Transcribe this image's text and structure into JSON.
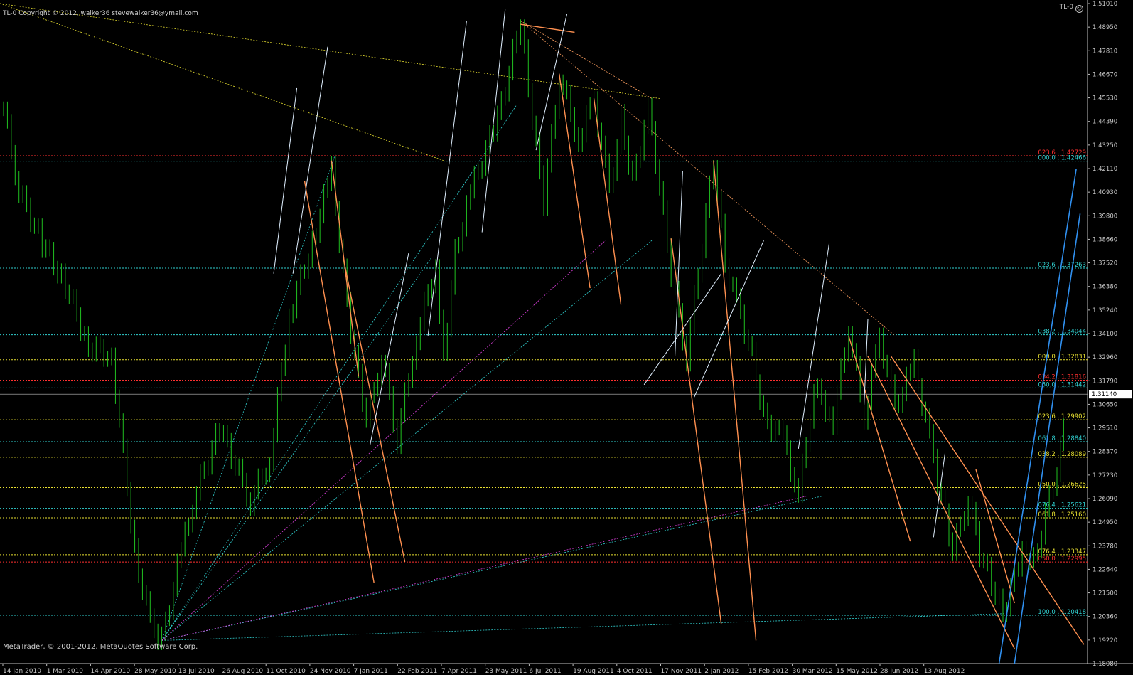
{
  "header": {
    "copyright": "TL-0  Copyright © 2012, walker36  stevewalker36@ymail.com",
    "symbol": "TL-0"
  },
  "footer": {
    "text": "MetaTrader, © 2001-2012, MetaQuotes Software Corp."
  },
  "chart_data": {
    "type": "candlestick",
    "current_price": "1.31140",
    "y_ticks": [
      "1.51010",
      "1.48950",
      "1.47810",
      "1.46670",
      "1.45530",
      "1.44390",
      "1.43250",
      "1.42110",
      "1.40930",
      "1.39800",
      "1.38660",
      "1.37520",
      "1.36380",
      "1.35240",
      "1.34100",
      "1.32960",
      "1.31790",
      "1.30650",
      "1.29510",
      "1.28370",
      "1.27230",
      "1.26090",
      "1.24950",
      "1.23780",
      "1.22640",
      "1.21500",
      "1.20360",
      "1.19220",
      "1.18080"
    ],
    "ylim": [
      1.1808,
      1.5101
    ],
    "x_ticks": [
      "14 Jan 2010",
      "1 Mar 2010",
      "14 Apr 2010",
      "28 May 2010",
      "13 Jul 2010",
      "26 Aug 2010",
      "11 Oct 2010",
      "24 Nov 2010",
      "7 Jan 2011",
      "22 Feb 2011",
      "7 Apr 2011",
      "23 May 2011",
      "6 Jul 2011",
      "19 Aug 2011",
      "4 Oct 2011",
      "17 Nov 2011",
      "2 Jan 2012",
      "15 Feb 2012",
      "30 Mar 2012",
      "15 May 2012",
      "28 Jun 2012",
      "13 Aug 2012"
    ],
    "fib_levels": [
      {
        "label": "023.6 , 1.42729",
        "price": 1.42729,
        "color": "#ff3030",
        "style": "dotted"
      },
      {
        "label": "000.0 , 1.42466",
        "price": 1.42466,
        "color": "#30d0d0",
        "style": "dotted"
      },
      {
        "label": "023.6 , 1.37263",
        "price": 1.37263,
        "color": "#30d0d0",
        "style": "dotted"
      },
      {
        "label": "038.2 , 1.34044",
        "price": 1.34044,
        "color": "#30d0d0",
        "style": "dotted"
      },
      {
        "label": "000.0 , 1.32831",
        "price": 1.32831,
        "color": "#e8e030",
        "style": "dotted"
      },
      {
        "label": "034.2 , 1.31816",
        "price": 1.31816,
        "color": "#ff3030",
        "style": "dotted"
      },
      {
        "label": "050.0 , 1.31442",
        "price": 1.31442,
        "color": "#30d0d0",
        "style": "dotted"
      },
      {
        "label": "023.6 , 1.29902",
        "price": 1.29902,
        "color": "#e8e030",
        "style": "dotted"
      },
      {
        "label": "061.8 , 1.28840",
        "price": 1.2884,
        "color": "#30d0d0",
        "style": "dotted"
      },
      {
        "label": "038.2 , 1.28089",
        "price": 1.28089,
        "color": "#e8e030",
        "style": "dotted"
      },
      {
        "label": "050.0 , 1.26625",
        "price": 1.26625,
        "color": "#e8e030",
        "style": "dotted"
      },
      {
        "label": "076.4 , 1.25621",
        "price": 1.25621,
        "color": "#30d0d0",
        "style": "dotted"
      },
      {
        "label": "061.8 , 1.25160",
        "price": 1.2516,
        "color": "#e8e030",
        "style": "dotted"
      },
      {
        "label": "076.4 , 1.23347",
        "price": 1.23347,
        "color": "#e8e030",
        "style": "dotted"
      },
      {
        "label": "050.0 , 1.22995",
        "price": 1.22995,
        "color": "#ff3030",
        "style": "dotted"
      },
      {
        "label": "100.0 , 1.20418",
        "price": 1.20418,
        "color": "#30d0d0",
        "style": "dotted"
      }
    ],
    "price_path": [
      [
        1.45,
        0
      ],
      [
        1.41,
        0.02
      ],
      [
        1.385,
        0.05
      ],
      [
        1.365,
        0.08
      ],
      [
        1.335,
        0.11
      ],
      [
        1.33,
        0.14
      ],
      [
        1.235,
        0.17
      ],
      [
        1.2,
        0.19
      ],
      [
        1.192,
        0.205
      ],
      [
        1.235,
        0.23
      ],
      [
        1.265,
        0.25
      ],
      [
        1.295,
        0.28
      ],
      [
        1.26,
        0.32
      ],
      [
        1.28,
        0.345
      ],
      [
        1.35,
        0.37
      ],
      [
        1.385,
        0.4
      ],
      [
        1.42,
        0.425
      ],
      [
        1.37,
        0.44
      ],
      [
        1.33,
        0.455
      ],
      [
        1.299,
        0.47
      ],
      [
        1.33,
        0.49
      ],
      [
        1.29,
        0.51
      ],
      [
        1.34,
        0.535
      ],
      [
        1.375,
        0.56
      ],
      [
        1.33,
        0.57
      ],
      [
        1.38,
        0.585
      ],
      [
        1.415,
        0.61
      ],
      [
        1.445,
        0.64
      ],
      [
        1.492,
        0.67
      ],
      [
        1.445,
        0.685
      ],
      [
        1.405,
        0.7
      ],
      [
        1.467,
        0.72
      ],
      [
        1.435,
        0.745
      ],
      [
        1.455,
        0.765
      ],
      [
        1.41,
        0.785
      ],
      [
        1.445,
        0.8
      ],
      [
        1.415,
        0.815
      ],
      [
        1.45,
        0.835
      ],
      [
        1.412,
        0.85
      ],
      [
        1.37,
        0.865
      ],
      [
        1.33,
        0.885
      ],
      [
        1.425,
        0.92
      ],
      [
        1.375,
        0.935
      ],
      [
        1.35,
        0.955
      ],
      [
        1.33,
        0.97
      ],
      [
        1.3,
        0.985
      ],
      [
        1.29,
        1.01
      ],
      [
        1.262,
        1.03
      ],
      [
        1.315,
        1.05
      ],
      [
        1.299,
        1.075
      ],
      [
        1.345,
        1.095
      ],
      [
        1.3,
        1.115
      ],
      [
        1.34,
        1.135
      ],
      [
        1.305,
        1.155
      ],
      [
        1.326,
        1.18
      ],
      [
        1.29,
        1.2
      ],
      [
        1.26,
        1.215
      ],
      [
        1.235,
        1.23
      ],
      [
        1.262,
        1.25
      ],
      [
        1.235,
        1.265
      ],
      [
        1.22,
        1.28
      ],
      [
        1.205,
        1.295
      ],
      [
        1.235,
        1.32
      ],
      [
        1.23,
        1.335
      ],
      [
        1.26,
        1.355
      ],
      [
        1.27,
        1.365
      ],
      [
        1.314,
        1.378
      ]
    ]
  }
}
